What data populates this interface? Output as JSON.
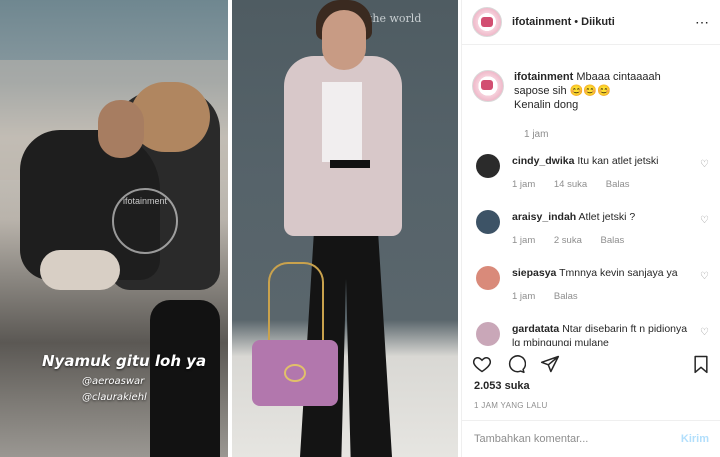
{
  "left_image": {
    "watermark_text": "ifotainment",
    "caption": "Nyamuk gitu loh ya",
    "mentions": [
      "@aeroaswar",
      "@claurakiehl"
    ]
  },
  "right_image": {
    "background_text": "the world"
  },
  "header": {
    "username": "ifotainment",
    "separator": "•",
    "follow_status": "Diikuti",
    "more_icon": "⋯"
  },
  "caption": {
    "username": "ifotainment",
    "text": "Mbaaa cintaaaah sapose sih 😊😊😊",
    "text2": "Kenalin dong",
    "time": "1 jam"
  },
  "comments": [
    {
      "username": "cindy_dwika",
      "text": "Itu kan atlet jetski",
      "time": "1 jam",
      "likes": "14 suka",
      "reply": "Balas",
      "avatar_color": "#2b2b2b"
    },
    {
      "username": "araisy_indah",
      "text": "Atlet jetski ?",
      "time": "1 jam",
      "likes": "2 suka",
      "reply": "Balas",
      "avatar_color": "#3d5366"
    },
    {
      "username": "siepasya",
      "text": "Tmnnya kevin sanjaya ya",
      "time": "1 jam",
      "likes": "",
      "reply": "Balas",
      "avatar_color": "#d98a7a"
    },
    {
      "username": "gardatata",
      "text": "Ntar disebarin ft n pidionya lg mbingungi mulane",
      "time": "",
      "likes": "",
      "reply": "",
      "avatar_color": "#c9a7b8"
    }
  ],
  "actions": {
    "icons": [
      "heart-icon",
      "comment-icon",
      "share-icon",
      "bookmark-icon"
    ]
  },
  "likes_text": "2.053 suka",
  "post_time": "1 JAM YANG LALU",
  "add_comment": {
    "placeholder": "Tambahkan komentar...",
    "send_label": "Kirim"
  }
}
